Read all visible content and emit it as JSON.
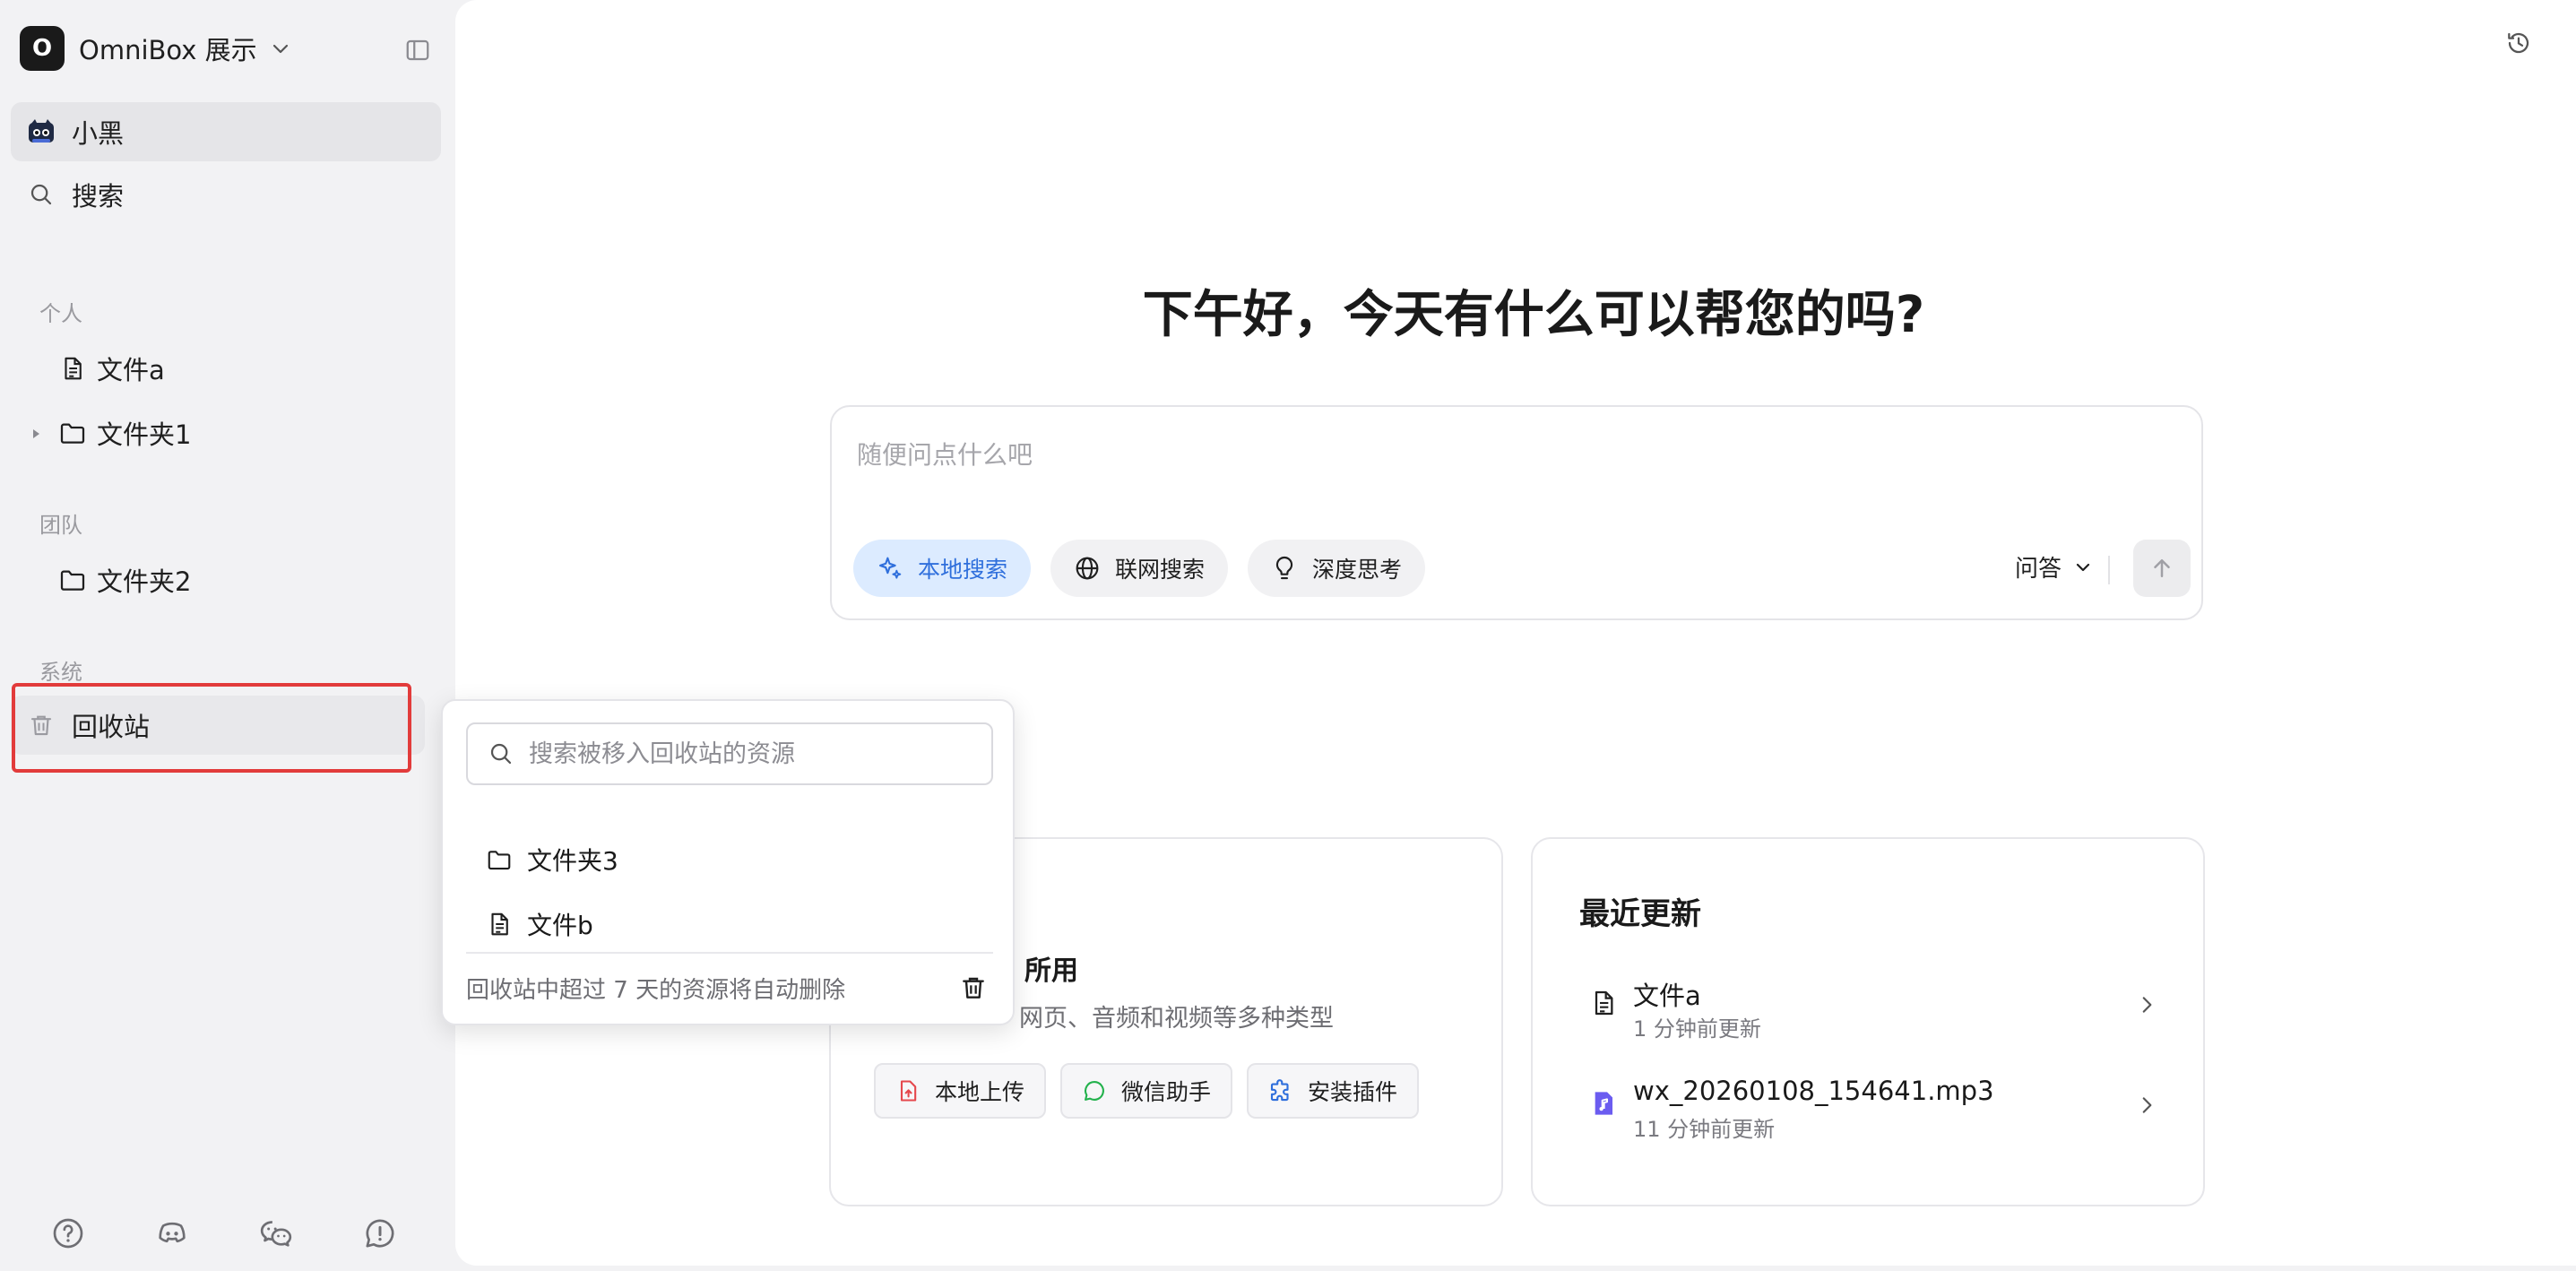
{
  "workspace": {
    "logo_letter": "O",
    "name": "OmniBox 展示"
  },
  "sidebar": {
    "user_label": "小黑",
    "search_label": "搜索",
    "sections": {
      "personal": "个人",
      "team": "团队",
      "system": "系统"
    },
    "personal_items": [
      {
        "label": "文件a",
        "type": "file"
      },
      {
        "label": "文件夹1",
        "type": "folder"
      }
    ],
    "team_items": [
      {
        "label": "文件夹2",
        "type": "folder"
      }
    ],
    "trash_label": "回收站",
    "bottom_icons": [
      "help-icon",
      "discord-icon",
      "wechat-icon",
      "feedback-icon"
    ]
  },
  "main": {
    "greeting": "下午好，今天有什么可以帮您的吗?",
    "chat": {
      "placeholder": "随便问点什么吧",
      "chips": [
        {
          "label": "本地搜索",
          "active": true
        },
        {
          "label": "联网搜索",
          "active": false
        },
        {
          "label": "深度思考",
          "active": false
        }
      ],
      "mode": "问答"
    },
    "left_card": {
      "title_fragment": "所用",
      "description": "网页、音频和视频等多种类型",
      "buttons": [
        "本地上传",
        "微信助手",
        "安装插件"
      ]
    },
    "recent": {
      "title": "最近更新",
      "items": [
        {
          "name": "文件a",
          "time": "1 分钟前更新",
          "icon": "document-icon"
        },
        {
          "name": "wx_20260108_154641.mp3",
          "time": "11 分钟前更新",
          "icon": "audio-file-icon"
        }
      ]
    }
  },
  "trash_popover": {
    "search_placeholder": "搜索被移入回收站的资源",
    "items": [
      {
        "label": "文件夹3",
        "type": "folder"
      },
      {
        "label": "文件b",
        "type": "file"
      }
    ],
    "footer": "回收站中超过 7 天的资源将自动删除"
  },
  "colors": {
    "accent_blue": "#2f6fdc",
    "active_chip_bg": "#dcebff",
    "highlight_red": "#e23b3b"
  }
}
